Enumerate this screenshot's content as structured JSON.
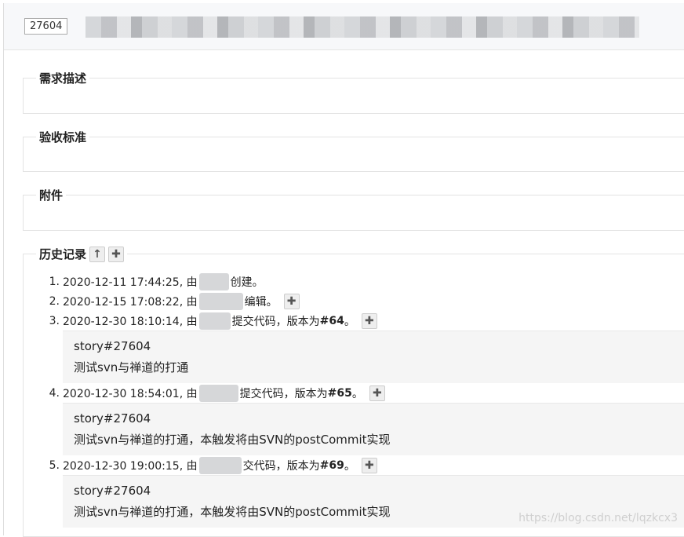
{
  "header": {
    "story_id": "27604"
  },
  "sections": {
    "desc": "需求描述",
    "criteria": "验收标准",
    "attachments": "附件",
    "history": "历史记录"
  },
  "history": [
    {
      "num": "1.",
      "time": "2020-12-11 17:44:25, 由",
      "action": "创建。",
      "version": "",
      "comment": []
    },
    {
      "num": "2.",
      "time": "2020-12-15 17:08:22, 由",
      "action": "编辑。",
      "version": "",
      "comment": []
    },
    {
      "num": "3.",
      "time": "2020-12-30 18:10:14, 由",
      "action": "提交代码，版本为",
      "version": "#64",
      "suffix": "。",
      "comment": [
        "story#27604",
        "测试svn与禅道的打通"
      ]
    },
    {
      "num": "4.",
      "time": "2020-12-30 18:54:01, 由",
      "action": "提交代码，版本为",
      "version": "#65",
      "suffix": "。",
      "comment": [
        "story#27604",
        "测试svn与禅道的打通，本触发将由SVN的postCommit实现"
      ]
    },
    {
      "num": "5.",
      "time": "2020-12-30 19:00:15, 由",
      "action": "交代码，版本为",
      "version": "#69",
      "suffix": "。",
      "comment": [
        "story#27604",
        "测试svn与禅道的打通，本触发将由SVN的postCommit实现"
      ]
    }
  ],
  "watermark": "https://blog.csdn.net/lqzkcx3"
}
